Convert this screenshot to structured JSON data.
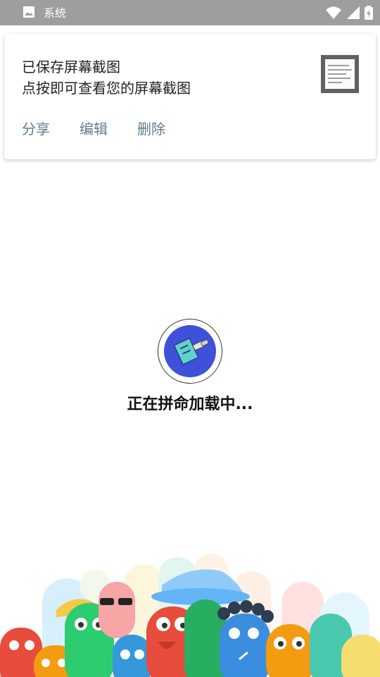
{
  "status_bar": {
    "title": "系统",
    "app_icon": "image-icon",
    "icons": [
      "wifi-icon",
      "signal-icon",
      "battery-icon"
    ],
    "background": "#9e9e9e"
  },
  "notification": {
    "title": "已保存屏幕截图",
    "text": "点按即可查看您的屏幕截图",
    "thumbnail_icon": "screenshot-thumbnail",
    "actions": [
      {
        "label": "分享"
      },
      {
        "label": "编辑"
      },
      {
        "label": "删除"
      }
    ],
    "action_color": "#607d8b"
  },
  "loading": {
    "text": "正在拼命加载中...",
    "logo_icon": "paintbrush-logo-icon",
    "logo_color": "#3f51d8"
  },
  "illustration": {
    "name": "colorful-characters-illustration"
  }
}
